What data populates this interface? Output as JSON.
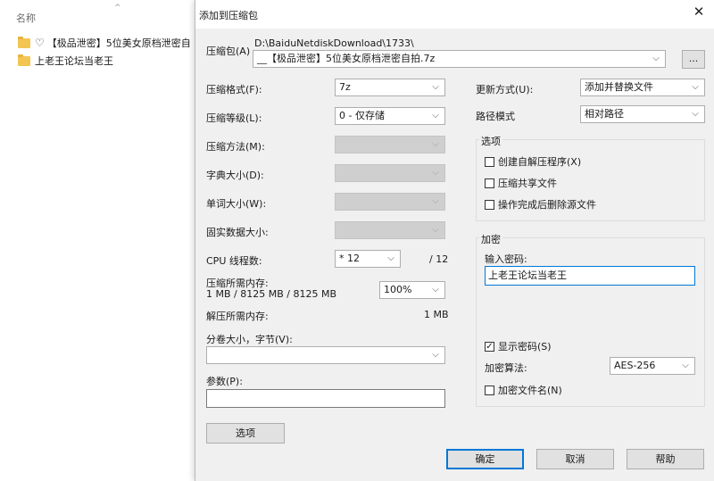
{
  "explorer": {
    "column_name": "名称",
    "rows": [
      {
        "text": "【极品泄密】5位美女原档泄密自"
      },
      {
        "text": "上老王论坛当老王"
      }
    ]
  },
  "dialog": {
    "title": "添加到压缩包",
    "archive_label": "压缩包(A)",
    "archive_path": "D:\\BaiduNetdiskDownload\\1733\\",
    "archive_name": "__【极品泄密】5位美女原档泄密自拍.7z",
    "browse_label": "...",
    "format_label": "压缩格式(F):",
    "format_value": "7z",
    "level_label": "压缩等级(L):",
    "level_value": "0 - 仅存储",
    "method_label": "压缩方法(M):",
    "dict_label": "字典大小(D):",
    "word_label": "单词大小(W):",
    "solid_label": "固实数据大小:",
    "cpu_label": "CPU 线程数:",
    "cpu_value": "* 12",
    "cpu_total": "/ 12",
    "mem_comp_label": "压缩所需内存:",
    "mem_comp_values": "1 MB / 8125 MB / 8125 MB",
    "mem_percent": "100%",
    "mem_decomp_label": "解压所需内存:",
    "mem_decomp_value": "1 MB",
    "split_label": "分卷大小，字节(V):",
    "params_label": "参数(P):",
    "options_button": "选项",
    "update_label": "更新方式(U):",
    "update_value": "添加并替换文件",
    "path_mode_label": "路径模式",
    "path_mode_value": "相对路径",
    "options_group": "选项",
    "opt_sfx": "创建自解压程序(X)",
    "opt_shared": "压缩共享文件",
    "opt_delete": "操作完成后删除源文件",
    "enc_group": "加密",
    "pwd_label": "输入密码:",
    "pwd_value": "上老王论坛当老王",
    "show_pwd": "显示密码(S)",
    "show_pwd_check": "✓",
    "enc_method_label": "加密算法:",
    "enc_method_value": "AES-256",
    "enc_names": "加密文件名(N)",
    "ok": "确定",
    "cancel": "取消",
    "help": "帮助"
  }
}
